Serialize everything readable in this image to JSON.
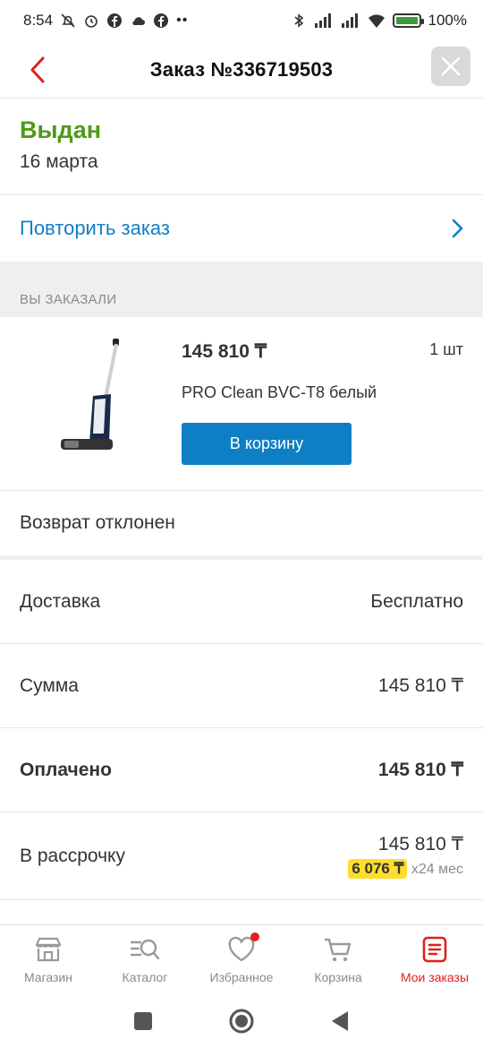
{
  "status_bar": {
    "time": "8:54",
    "battery": "100%",
    "battery_level": 1.0
  },
  "header": {
    "title": "Заказ №336719503"
  },
  "order": {
    "status": "Выдан",
    "date": "16 марта",
    "repeat_label": "Повторить заказ",
    "section_label": "ВЫ ЗАКАЗАЛИ"
  },
  "product": {
    "price": "145 810 ₸",
    "qty": "1 шт",
    "name": "PRO Clean BVC-T8 белый",
    "cart_button": "В корзину"
  },
  "return_status": "Возврат отклонен",
  "summary": {
    "delivery_label": "Доставка",
    "delivery_value": "Бесплатно",
    "sum_label": "Сумма",
    "sum_value": "145 810 ₸",
    "paid_label": "Оплачено",
    "paid_value": "145 810 ₸",
    "installment_label": "В рассрочку",
    "installment_value": "145 810 ₸",
    "installment_monthly": "6 076 ₸",
    "installment_term": "x24 мес"
  },
  "nav": [
    {
      "label": "Магазин",
      "icon": "shop-icon"
    },
    {
      "label": "Каталог",
      "icon": "catalog-search-icon"
    },
    {
      "label": "Избранное",
      "icon": "heart-icon"
    },
    {
      "label": "Корзина",
      "icon": "cart-icon"
    },
    {
      "label": "Мои заказы",
      "icon": "orders-icon"
    }
  ],
  "colors": {
    "accent_red": "#e02020",
    "link_blue": "#0f7fc5",
    "status_green": "#4e9a19",
    "badge_yellow": "#ffdd2d"
  }
}
